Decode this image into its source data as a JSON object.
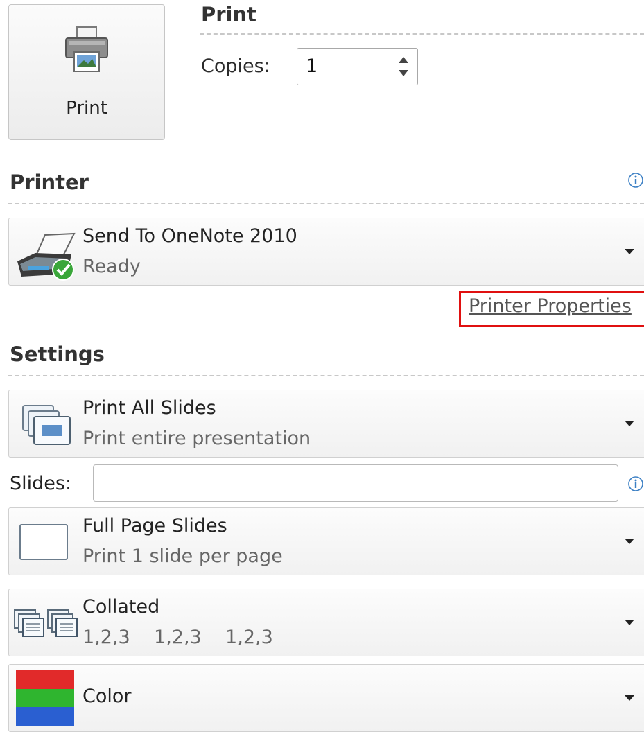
{
  "print_button": {
    "label": "Print",
    "icon": "printer-icon"
  },
  "print_section": {
    "title": "Print",
    "copies_label": "Copies:",
    "copies_value": "1"
  },
  "printer_section": {
    "title": "Printer",
    "printer_name": "Send To OneNote 2010",
    "printer_status": "Ready",
    "properties_link": "Printer Properties"
  },
  "settings_section": {
    "title": "Settings",
    "print_range": {
      "title": "Print All Slides",
      "subtitle": "Print entire presentation"
    },
    "slides_label": "Slides:",
    "slides_value": "",
    "layout": {
      "title": "Full Page Slides",
      "subtitle": "Print 1 slide per page"
    },
    "collation": {
      "title": "Collated",
      "subtitle": "1,2,3    1,2,3    1,2,3"
    },
    "color": {
      "title": "Color"
    }
  },
  "colors": {
    "highlight_border": "#e01010",
    "check_green": "#3aa63a",
    "info_blue": "#3b7fc4"
  }
}
